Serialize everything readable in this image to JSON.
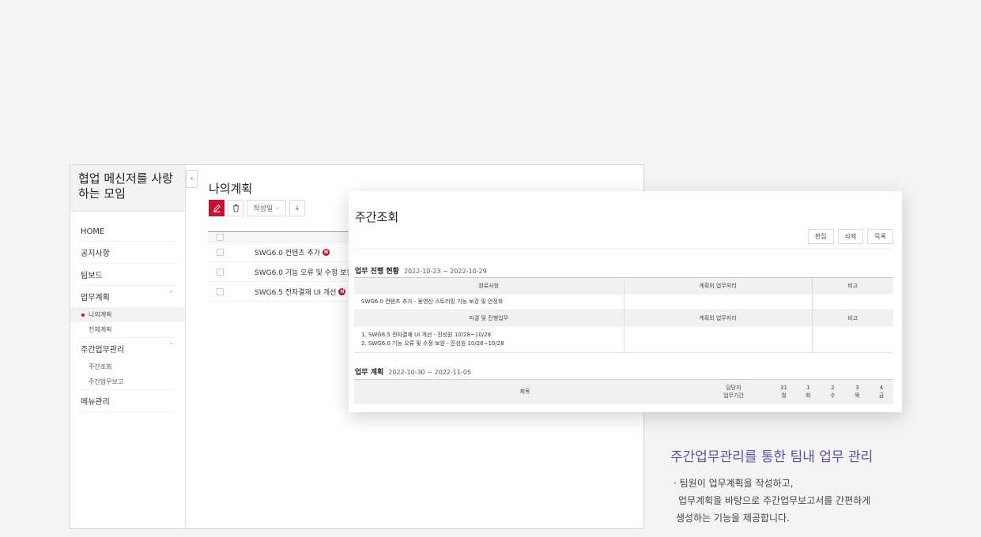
{
  "app": {
    "group_title": "협업 메신저를 사랑하는 모임",
    "nav": [
      {
        "label": "HOME"
      },
      {
        "label": "공지사항"
      },
      {
        "label": "팀보드"
      },
      {
        "label": "업무계획",
        "sub": [
          "나의계획",
          "전체계획"
        ]
      },
      {
        "label": "주간업무관리",
        "sub": [
          "주간조회",
          "주간업무보고"
        ]
      },
      {
        "label": "메뉴관리"
      }
    ],
    "collapse_icon": "‹",
    "main_title": "나의계획",
    "sort_label": "작성일",
    "rows": [
      {
        "title": "SWG6.0 컨텐츠 추가",
        "new": true
      },
      {
        "title": "SWG6.0 기능 오류 및 수정 보완",
        "new": false
      },
      {
        "title": "SWG6.5 전자결재 UI 개선",
        "new": true
      }
    ],
    "new_badge": "N"
  },
  "weekly": {
    "title": "주간조회",
    "buttons": {
      "edit": "편집",
      "delete": "삭제",
      "list": "목록"
    },
    "progress": {
      "heading": "업무 진행 현황",
      "range": "2022-10-23 ~ 2022-10-29",
      "headers": [
        "완료사항",
        "계획외 업무처리",
        "비고"
      ],
      "done_item": "SWG6.0 컨텐츠 추가 - 동영산 스트리밍 기능 보강 및 안정화",
      "headers2": [
        "미결 및 진행업무",
        "계획외 업무처리",
        "비고"
      ],
      "pending_1": "1. SWG6.5 전자결재 UI 개선 - 진성원 10/28~10/28",
      "pending_2": "2. SWG6.0 기능 오류 및 수정 보완 - 진성원 10/28~10/28"
    },
    "plan": {
      "heading": "업무 계획",
      "range": "2022-10-30 ~ 2022-11-05",
      "col_title": "제목",
      "col_owner": "담당자",
      "col_period": "업무기간",
      "days": [
        {
          "date": "31",
          "dow": "월"
        },
        {
          "date": "1",
          "dow": "화"
        },
        {
          "date": "2",
          "dow": "수"
        },
        {
          "date": "3",
          "dow": "목"
        },
        {
          "date": "4",
          "dow": "금"
        }
      ]
    }
  },
  "promo": {
    "title": "주간업무관리를 통한 팀내 업무 관리",
    "line1": "· 팀원이 업무계획을 작성하고,",
    "line2": "업무계획을 바탕으로 주간업무보고서를 간편하게",
    "line3": "생성하는 기능을 제공합니다."
  },
  "colors": {
    "accent": "#c8102e",
    "promo": "#5b4fa8"
  }
}
